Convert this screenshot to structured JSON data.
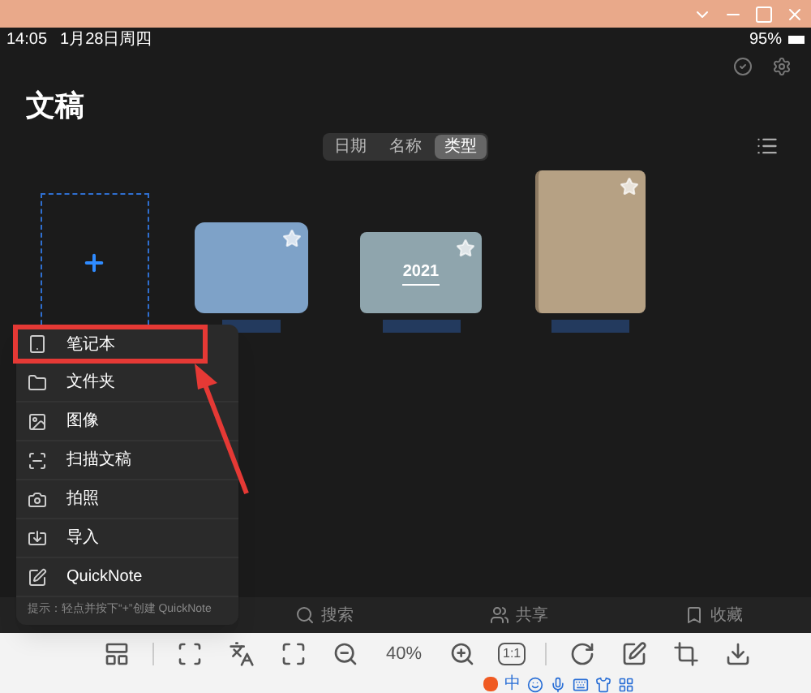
{
  "status_bar": {
    "time": "14:05",
    "date": "1月28日周四",
    "battery": "95%"
  },
  "title": "文稿",
  "sort_tabs": [
    {
      "label": "日期",
      "selected": false
    },
    {
      "label": "名称",
      "selected": false
    },
    {
      "label": "类型",
      "selected": true
    }
  ],
  "documents": [
    {
      "kind": "new"
    },
    {
      "kind": "folder",
      "starred": true
    },
    {
      "kind": "notebook",
      "cover_text": "2021",
      "starred": true
    },
    {
      "kind": "journal",
      "starred": true
    }
  ],
  "new_menu": {
    "items": [
      {
        "label": "笔记本",
        "highlighted": true
      },
      {
        "label": "文件夹",
        "highlighted": false
      },
      {
        "label": "图像",
        "highlighted": false
      },
      {
        "label": "扫描文稿",
        "highlighted": false
      },
      {
        "label": "拍照",
        "highlighted": false
      },
      {
        "label": "导入",
        "highlighted": false
      },
      {
        "label": "QuickNote",
        "highlighted": false
      }
    ],
    "hint": "提示：轻点并按下“+”创建 QuickNote"
  },
  "bottom_tabs": [
    {
      "label": "搜索"
    },
    {
      "label": "共享"
    },
    {
      "label": "收藏"
    }
  ],
  "viewer_toolbar": {
    "zoom": "40%",
    "actual_size": "1:1"
  },
  "ime_bar": {
    "mode": "中"
  }
}
